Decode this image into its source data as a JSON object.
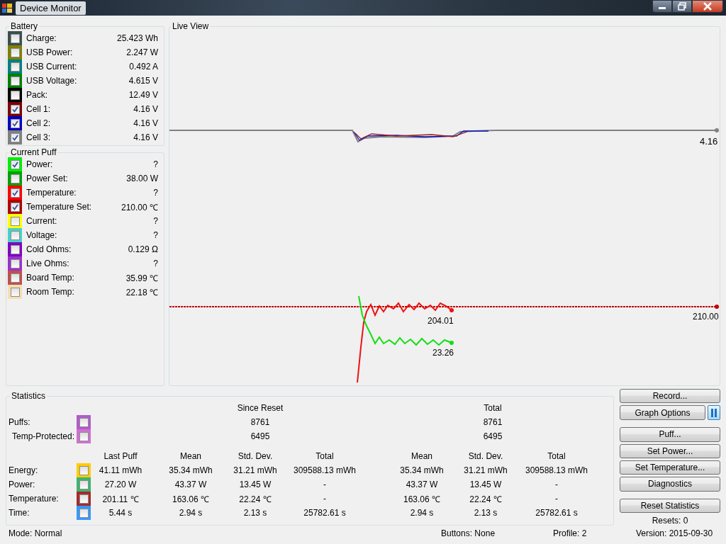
{
  "window": {
    "title": "Device Monitor"
  },
  "battery": {
    "title": "Battery",
    "items": [
      {
        "label": "Charge:",
        "value": "25.423 Wh",
        "checked": false,
        "color": "#3c4f4f"
      },
      {
        "label": "USB Power:",
        "value": "2.247 W",
        "checked": false,
        "color": "#808000"
      },
      {
        "label": "USB Current:",
        "value": "0.492 A",
        "checked": false,
        "color": "#008080"
      },
      {
        "label": "USB Voltage:",
        "value": "4.615 V",
        "checked": false,
        "color": "#008000"
      },
      {
        "label": "Pack:",
        "value": "12.49 V",
        "checked": false,
        "color": "#000000"
      },
      {
        "label": "Cell 1:",
        "value": "4.16 V",
        "checked": true,
        "color": "#800000"
      },
      {
        "label": "Cell 2:",
        "value": "4.16 V",
        "checked": true,
        "color": "#0000c0"
      },
      {
        "label": "Cell 3:",
        "value": "4.16 V",
        "checked": true,
        "color": "#808080"
      }
    ]
  },
  "current_puff": {
    "title": "Current Puff",
    "items": [
      {
        "label": "Power:",
        "value": "?",
        "checked": true,
        "color": "#00ee00"
      },
      {
        "label": "Power Set:",
        "value": "38.00 W",
        "checked": false,
        "color": "#00a000"
      },
      {
        "label": "Temperature:",
        "value": "?",
        "checked": true,
        "color": "#ff0000"
      },
      {
        "label": "Temperature Set:",
        "value": "210.00 ℃",
        "checked": true,
        "color": "#b00000"
      },
      {
        "label": "Current:",
        "value": "?",
        "checked": false,
        "color": "#ffff00"
      },
      {
        "label": "Voltage:",
        "value": "?",
        "checked": false,
        "color": "#48d1cc"
      },
      {
        "label": "Cold Ohms:",
        "value": "0.129 Ω",
        "checked": false,
        "color": "#8000c0"
      },
      {
        "label": "Live Ohms:",
        "value": "?",
        "checked": false,
        "color": "#9933cc"
      },
      {
        "label": "Board Temp:",
        "value": "35.99 ℃",
        "checked": false,
        "color": "#c0504d"
      },
      {
        "label": "Room Temp:",
        "value": "22.18 ℃",
        "checked": false,
        "color": "#f5deb3"
      }
    ]
  },
  "live_view": {
    "title": "Live View",
    "labels": [
      {
        "kind": "cell",
        "text": "4.16"
      },
      {
        "kind": "temperature",
        "text": "204.01"
      },
      {
        "kind": "set",
        "text": "210.00"
      },
      {
        "kind": "power",
        "text": "23.26"
      }
    ]
  },
  "statistics": {
    "title": "Statistics",
    "group_headers": [
      "Since Reset",
      "Total"
    ],
    "counts": [
      {
        "label": "Puffs:",
        "checked": false,
        "color": "#b05cc8",
        "since_reset": "8761",
        "total": "8761"
      },
      {
        "label": "Temp-Protected:",
        "checked": false,
        "color": "#d070d0",
        "since_reset": "6495",
        "total": "6495"
      }
    ],
    "columns": [
      "Last Puff",
      "Mean",
      "Std. Dev.",
      "Total",
      "Mean",
      "Std. Dev.",
      "Total"
    ],
    "rows": [
      {
        "label": "Energy:",
        "checked": false,
        "color": "#ffcc00",
        "cells": [
          "41.11 mWh",
          "35.34 mWh",
          "31.21 mWh",
          "309588.13 mWh",
          "35.34 mWh",
          "31.21 mWh",
          "309588.13 mWh"
        ]
      },
      {
        "label": "Power:",
        "checked": false,
        "color": "#3cb371",
        "cells": [
          "27.20 W",
          "43.37 W",
          "13.45 W",
          "-",
          "43.37 W",
          "13.45 W",
          "-"
        ]
      },
      {
        "label": "Temperature:",
        "checked": false,
        "color": "#a52a2a",
        "cells": [
          "201.11 ℃",
          "163.06 ℃",
          "22.24 ℃",
          "-",
          "163.06 ℃",
          "22.24 ℃",
          "-"
        ]
      },
      {
        "label": "Time:",
        "checked": false,
        "color": "#3399ff",
        "cells": [
          "5.44 s",
          "2.94 s",
          "2.13 s",
          "25782.61 s",
          "2.94 s",
          "2.13 s",
          "25782.61 s"
        ]
      }
    ]
  },
  "buttons": [
    {
      "kind": "record",
      "label": "Record..."
    },
    {
      "kind": "graph",
      "label": "Graph Options"
    },
    {
      "kind": "puff",
      "label": "Puff..."
    },
    {
      "kind": "power",
      "label": "Set Power..."
    },
    {
      "kind": "temperature",
      "label": "Set Temperature..."
    },
    {
      "kind": "diagnostics",
      "label": "Diagnostics"
    },
    {
      "kind": "reset",
      "label": "Reset Statistics"
    }
  ],
  "resets": "Resets: 0",
  "status_bar": {
    "mode": "Mode: Normal",
    "buttons": "Buttons: None",
    "profile": "Profile: 2",
    "version": "Version: 2015-09-30"
  }
}
